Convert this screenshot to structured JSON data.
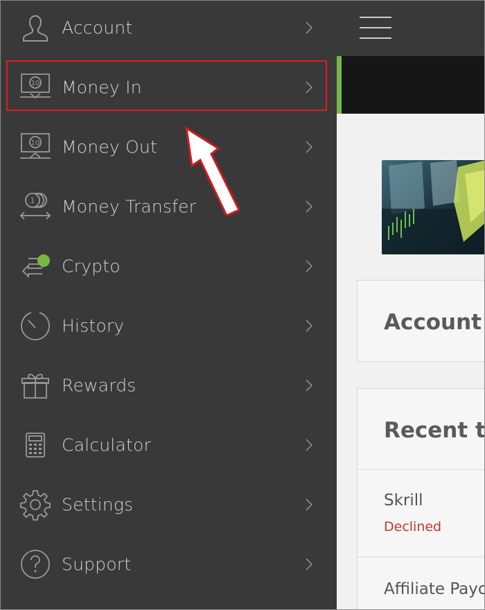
{
  "sidebar": {
    "items": [
      {
        "label": "Account",
        "icon": "user-icon"
      },
      {
        "label": "Money In",
        "icon": "money-in-icon"
      },
      {
        "label": "Money Out",
        "icon": "money-out-icon"
      },
      {
        "label": "Money Transfer",
        "icon": "money-transfer-icon"
      },
      {
        "label": "Crypto",
        "icon": "crypto-icon"
      },
      {
        "label": "History",
        "icon": "history-icon"
      },
      {
        "label": "Rewards",
        "icon": "gift-icon"
      },
      {
        "label": "Calculator",
        "icon": "calculator-icon"
      },
      {
        "label": "Settings",
        "icon": "gear-icon"
      },
      {
        "label": "Support",
        "icon": "question-icon"
      }
    ],
    "highlighted_item": "Money In",
    "money_icon_value": "10",
    "transfer_coin_value": "1"
  },
  "main": {
    "account_card_title": "Account",
    "recent_card_title": "Recent tr",
    "transactions": [
      {
        "name": "Skrill",
        "status": "Declined"
      },
      {
        "name": "Affiliate Payo",
        "status": ""
      }
    ]
  },
  "colors": {
    "sidebar_bg": "#393939",
    "accent_green": "#74b843",
    "annotation_red": "#e31b23",
    "declined_red": "#c0392b"
  }
}
